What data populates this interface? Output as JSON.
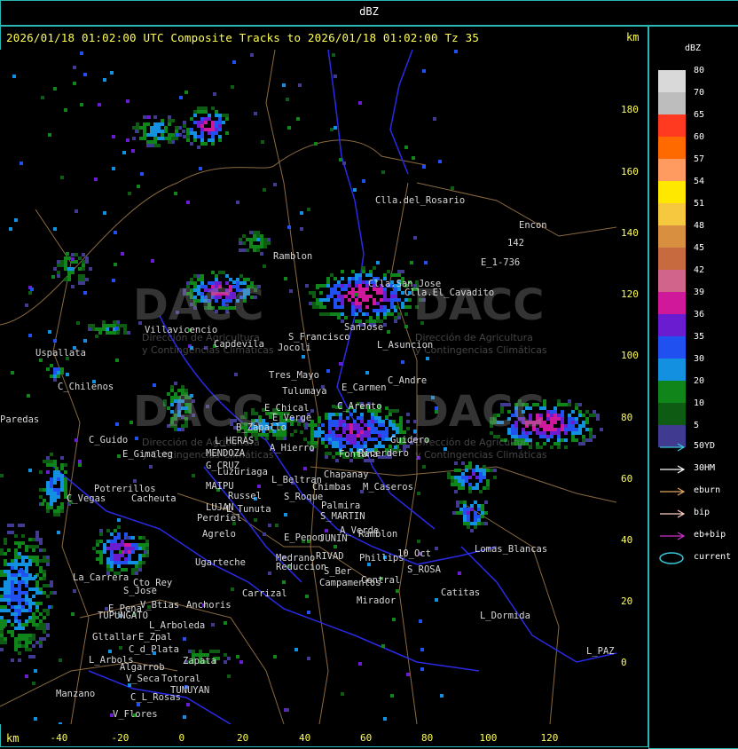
{
  "window": {
    "title": "dBZ"
  },
  "header": {
    "subtitle": "2026/01/18 01:02:00 UTC Composite Tracks to 2026/01/18 01:02:00 Tz 35",
    "km_top": "km",
    "km_bottom": "km"
  },
  "axes": {
    "x_ticks": [
      "-40",
      "-20",
      "0",
      "20",
      "40",
      "60",
      "80",
      "100",
      "120"
    ],
    "y_ticks": [
      "180",
      "160",
      "140",
      "120",
      "100",
      "80",
      "60",
      "40",
      "20",
      "0"
    ]
  },
  "watermark": {
    "text": "DACC",
    "sub1": "Dirección de Agricultura",
    "sub2": "y Contingencias Climáticas"
  },
  "cities": [
    {
      "name": "Clla.del_Rosario"
    },
    {
      "name": "Encon"
    },
    {
      "name": "142"
    },
    {
      "name": "E_1-736"
    },
    {
      "name": "Ramblon"
    },
    {
      "name": "Clla.San_Jose"
    },
    {
      "name": "Clla.El_Cavadito"
    },
    {
      "name": "Villavicencio"
    },
    {
      "name": "Capdevila"
    },
    {
      "name": "S_Francisco"
    },
    {
      "name": "Jocoli"
    },
    {
      "name": "SanJose"
    },
    {
      "name": "L_Asuncion"
    },
    {
      "name": "Uspallata"
    },
    {
      "name": "Tres_Mayo"
    },
    {
      "name": "C_Andre"
    },
    {
      "name": "C_Chilenos"
    },
    {
      "name": "Tulumaya"
    },
    {
      "name": "E_Carmen"
    },
    {
      "name": "E_Chical"
    },
    {
      "name": "C_Arento"
    },
    {
      "name": "E_Verge"
    },
    {
      "name": "B_Zapallo"
    },
    {
      "name": "Guidero"
    },
    {
      "name": "Paredas"
    },
    {
      "name": "C_Guido"
    },
    {
      "name": "L_HERAS"
    },
    {
      "name": "A_Hierro"
    },
    {
      "name": "Ricerdero"
    },
    {
      "name": "E_Gimaleg"
    },
    {
      "name": "MENDOZA"
    },
    {
      "name": "G_CRUZ"
    },
    {
      "name": "Luzuriaga"
    },
    {
      "name": "L_Beltran"
    },
    {
      "name": "Chapanay"
    },
    {
      "name": "Potrerillos"
    },
    {
      "name": "MAIPU"
    },
    {
      "name": "Cacheuta"
    },
    {
      "name": "Russel"
    },
    {
      "name": "S_Roque"
    },
    {
      "name": "C_Vegas"
    },
    {
      "name": "LUJAN"
    },
    {
      "name": "L_Tunuta"
    },
    {
      "name": "Perdriel"
    },
    {
      "name": "S_MARTIN"
    },
    {
      "name": "Agrelo"
    },
    {
      "name": "A_Verde"
    },
    {
      "name": "Ramblon"
    },
    {
      "name": "E_Penon"
    },
    {
      "name": "JUNIN"
    },
    {
      "name": "Medrano"
    },
    {
      "name": "RIVAD"
    },
    {
      "name": "Phillips"
    },
    {
      "name": "Lomas_Blancas"
    },
    {
      "name": "Ugarteche"
    },
    {
      "name": "Reduccion"
    },
    {
      "name": "S_Ber"
    },
    {
      "name": "10_Oct"
    },
    {
      "name": "S_ROSA"
    },
    {
      "name": "La_Carrera"
    },
    {
      "name": "Cto_Rey"
    },
    {
      "name": "Campamentos"
    },
    {
      "name": "Central"
    },
    {
      "name": "S_Jose"
    },
    {
      "name": "Carrizal"
    },
    {
      "name": "Catitas"
    },
    {
      "name": "E_Pena"
    },
    {
      "name": "V_Btias"
    },
    {
      "name": "Anchoris"
    },
    {
      "name": "Mirador"
    },
    {
      "name": "TUPUNGATO"
    },
    {
      "name": "L_Arboleda"
    },
    {
      "name": "L_Dormida"
    },
    {
      "name": "Gltallar"
    },
    {
      "name": "E_Zpal"
    },
    {
      "name": "C_d_Plata"
    },
    {
      "name": "L_Arbols"
    },
    {
      "name": "Zapata"
    },
    {
      "name": "L_PAZ"
    },
    {
      "name": "Algarrob"
    },
    {
      "name": "V_Seca"
    },
    {
      "name": "Totoral"
    },
    {
      "name": "TUNUYAN"
    },
    {
      "name": "Manzano"
    },
    {
      "name": "C_L_Rosas"
    },
    {
      "name": "V_Flores"
    },
    {
      "name": "Chimbas"
    },
    {
      "name": "M_Caseros"
    },
    {
      "name": "Palmira"
    },
    {
      "name": "Fontana"
    }
  ],
  "legend": {
    "title": "dBZ",
    "scale": [
      {
        "label": "80",
        "color": "#d9d9d9"
      },
      {
        "label": "70",
        "color": "#bdbdbd"
      },
      {
        "label": "65",
        "color": "#ff3a20"
      },
      {
        "label": "60",
        "color": "#ff6a00"
      },
      {
        "label": "57",
        "color": "#ff9a60"
      },
      {
        "label": "54",
        "color": "#ffe800"
      },
      {
        "label": "51",
        "color": "#f6c840"
      },
      {
        "label": "48",
        "color": "#d89040"
      },
      {
        "label": "45",
        "color": "#c86a40"
      },
      {
        "label": "42",
        "color": "#d0648a"
      },
      {
        "label": "39",
        "color": "#d0189a"
      },
      {
        "label": "36",
        "color": "#6a1cd0"
      },
      {
        "label": "35",
        "color": "#2050f0"
      },
      {
        "label": "30",
        "color": "#1490e0"
      },
      {
        "label": "20",
        "color": "#10861a"
      },
      {
        "label": "10",
        "color": "#0e5c14"
      },
      {
        "label": "5",
        "color": "#403a90"
      }
    ],
    "tracks": [
      {
        "label": "50YD",
        "color": "#38c8d8"
      },
      {
        "label": "30HM",
        "color": "#ffffff"
      },
      {
        "label": "eburn",
        "color": "#e0a860"
      },
      {
        "label": "bip",
        "color": "#ffd0c8"
      },
      {
        "label": "eb+bip",
        "color": "#d030d0"
      },
      {
        "label": "current",
        "color": "#38c8d8"
      }
    ]
  }
}
